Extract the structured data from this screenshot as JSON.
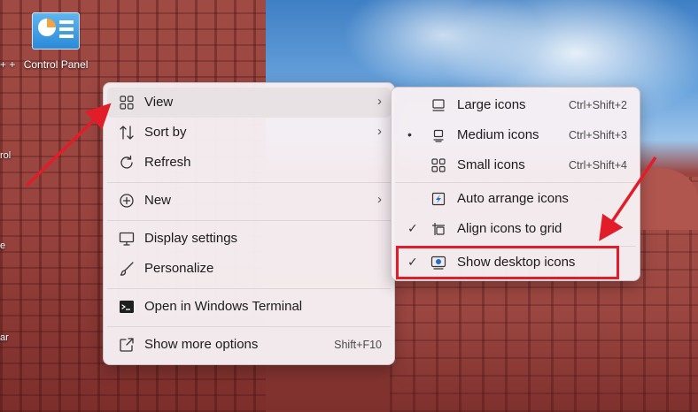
{
  "desktop": {
    "icon_label": "Control Panel",
    "label_prefix": "+ +",
    "edge_texts": [
      "rol",
      "e",
      "ar"
    ]
  },
  "main_menu": {
    "items": [
      {
        "label": "View",
        "icon": "grid-icon",
        "has_submenu": true,
        "highlighted": true
      },
      {
        "label": "Sort by",
        "icon": "sort-icon",
        "has_submenu": true
      },
      {
        "label": "Refresh",
        "icon": "refresh-icon"
      },
      {
        "label": "New",
        "icon": "plus-circle-icon",
        "has_submenu": true
      },
      {
        "label": "Display settings",
        "icon": "monitor-icon"
      },
      {
        "label": "Personalize",
        "icon": "brush-icon"
      },
      {
        "label": "Open in Windows Terminal",
        "icon": "terminal-icon"
      },
      {
        "label": "Show more options",
        "icon": "expand-icon",
        "shortcut": "Shift+F10"
      }
    ]
  },
  "view_submenu": {
    "items": [
      {
        "label": "Large icons",
        "icon": "large-icons-icon",
        "shortcut": "Ctrl+Shift+2"
      },
      {
        "label": "Medium icons",
        "icon": "medium-icons-icon",
        "shortcut": "Ctrl+Shift+3",
        "mark": "•"
      },
      {
        "label": "Small icons",
        "icon": "small-icons-icon",
        "shortcut": "Ctrl+Shift+4"
      },
      {
        "label": "Auto arrange icons",
        "icon": "auto-arrange-icon"
      },
      {
        "label": "Align icons to grid",
        "icon": "align-grid-icon",
        "mark": "✓"
      },
      {
        "label": "Show desktop icons",
        "icon": "show-desktop-icon",
        "mark": "✓"
      }
    ]
  },
  "colors": {
    "annotation": "#e11d2a",
    "menu_bg": "#f6f0f3",
    "highlight": "#e8e2e5"
  }
}
